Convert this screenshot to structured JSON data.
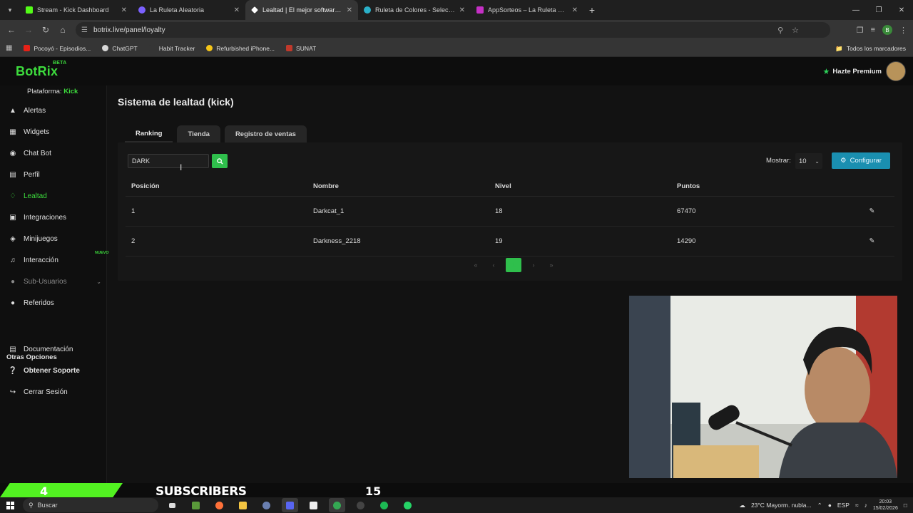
{
  "browser": {
    "tabs": [
      {
        "title": "Stream - Kick Dashboard",
        "favicon_color": "#53fc18",
        "active": false
      },
      {
        "title": "La Ruleta Aleatoria",
        "favicon_color": "#7b61ff",
        "active": false
      },
      {
        "title": "Lealtad | El mejor software para",
        "favicon_color": "#ffffff",
        "active": true
      },
      {
        "title": "Ruleta de Colores - Selecciona",
        "favicon_color": "#2ab0c8",
        "active": false
      },
      {
        "title": "AppSorteos – La Ruleta de la S",
        "favicon_color": "#c530c5",
        "active": false
      }
    ],
    "url": "botrix.live/panel/loyalty",
    "bookmarks": [
      {
        "label": "Pocoyó - Episodios...",
        "color": "#e62117"
      },
      {
        "label": "ChatGPT",
        "color": "#d9d9d9"
      },
      {
        "label": "Habit Tracker",
        "color": "#353535"
      },
      {
        "label": "Refurbished iPhone...",
        "color": "#f5c518"
      },
      {
        "label": "SUNAT",
        "color": "#c0392b"
      }
    ],
    "bookmarks_right": "Todos los marcadores",
    "profile_initial": "B"
  },
  "app": {
    "logo": "BotRix",
    "logo_badge": "BETA",
    "premium_label": "Hazte Premium",
    "platform_label": "Plataforma:",
    "platform_value": "Kick"
  },
  "sidebar": {
    "items": [
      {
        "label": "Alertas",
        "icon": "bell-icon"
      },
      {
        "label": "Widgets",
        "icon": "grid-icon"
      },
      {
        "label": "Chat Bot",
        "icon": "robot-icon"
      },
      {
        "label": "Perfil",
        "icon": "profile-card-icon"
      },
      {
        "label": "Lealtad",
        "icon": "trophy-icon"
      },
      {
        "label": "Integraciones",
        "icon": "plug-icon"
      },
      {
        "label": "Minijuegos",
        "icon": "gamepad-icon"
      },
      {
        "label": "Interacción",
        "icon": "music-note-icon"
      },
      {
        "label": "Sub-Usuarios",
        "icon": "users-icon"
      },
      {
        "label": "Referidos",
        "icon": "user-group-icon"
      }
    ],
    "nuevo_badge": "NUEVO",
    "otras_title": "Otras Opciones",
    "other_items": [
      {
        "label": "Documentación",
        "icon": "document-icon"
      },
      {
        "label": "Obtener Soporte",
        "icon": "question-icon"
      },
      {
        "label": "Cerrar Sesión",
        "icon": "logout-icon"
      }
    ]
  },
  "page": {
    "title": "Sistema de lealtad (kick)",
    "tabs": [
      "Ranking",
      "Tienda",
      "Registro de ventas"
    ],
    "search_value": "DARK",
    "mostrar_label": "Mostrar:",
    "mostrar_value": "10",
    "configurar_label": "Configurar",
    "columns": [
      "Posición",
      "Nombre",
      "Nivel",
      "Puntos"
    ],
    "rows": [
      {
        "posicion": "1",
        "nombre": "Darkcat_1",
        "nivel": "18",
        "puntos": "67470"
      },
      {
        "posicion": "2",
        "nombre": "Darkness_2218",
        "nivel": "19",
        "puntos": "14290"
      }
    ],
    "pagination": {
      "current": "1"
    }
  },
  "overlay": {
    "left_number": "4",
    "label": "SUBSCRIBERS",
    "right_number": "15"
  },
  "taskbar": {
    "search_placeholder": "Buscar",
    "weather": "23°C  Mayorm. nubla...",
    "language": "ESP",
    "time": "20:03",
    "date": "15/02/2026"
  },
  "colors": {
    "accent_green": "#3ddc3d",
    "button_green": "#2fbf4c",
    "configure_blue": "#1a8fb0"
  }
}
